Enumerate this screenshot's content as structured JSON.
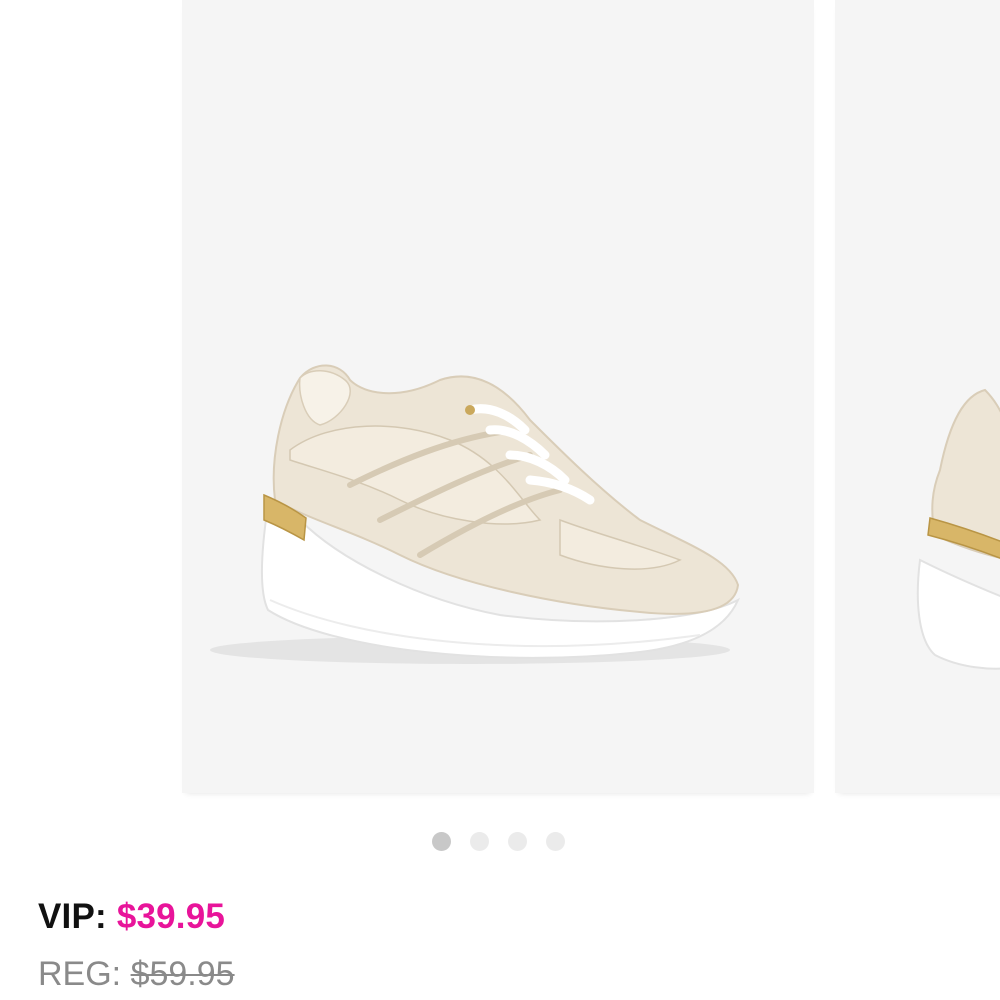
{
  "carousel": {
    "slides": [
      {
        "image": "beige-wedge-sneaker"
      },
      {
        "image": "beige-wedge-sneaker-alt-view"
      }
    ],
    "dots_total": 4,
    "active_index": 0
  },
  "pricing": {
    "vip_label": "VIP:",
    "vip_price": "$39.95",
    "reg_label": "REG:",
    "reg_price": "$59.95"
  },
  "colors": {
    "accent": "#e8149a",
    "image_background": "#f5f5f5",
    "dot_active": "#c8c8c8",
    "dot_inactive": "#ebebeb"
  }
}
